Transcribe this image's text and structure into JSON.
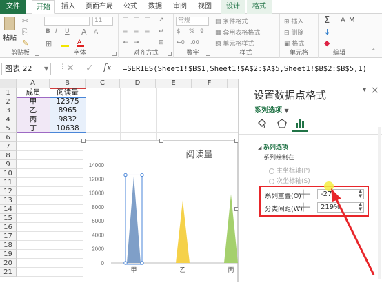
{
  "ribbon": {
    "tabs": [
      "文件",
      "开始",
      "插入",
      "页面布局",
      "公式",
      "数据",
      "审阅",
      "视图",
      "设计",
      "格式"
    ],
    "groups": {
      "clipboard": "剪贴板",
      "font": "字体",
      "alignment": "对齐方式",
      "number": "数字",
      "styles": "样式",
      "cells": "单元格",
      "editing": "编辑"
    },
    "paste_label": "粘贴",
    "font_size": "11",
    "font_bold": "B",
    "font_italic": "I",
    "font_underline": "U",
    "font_grow": "A",
    "font_shrink": "A",
    "number_format": "常规",
    "percent": "%",
    "comma": "9",
    "conditional_format": "条件格式",
    "table_format": "套用表格格式",
    "cell_styles": "单元格样式",
    "insert": "插入",
    "delete": "删除",
    "format": "格式",
    "sum_icon": "Σ",
    "sort_icon": "A",
    "find_icon": "M"
  },
  "formula_bar": {
    "name_box": "图表 22",
    "fx": "fx",
    "formula": "=SERIES(Sheet1!$B$1,Sheet1!$A$2:$A$5,Sheet1!$B$2:$B$5,1)"
  },
  "sheet": {
    "columns": [
      "A",
      "B",
      "C",
      "D",
      "E",
      "F"
    ],
    "rows": [
      "1",
      "2",
      "3",
      "4",
      "5",
      "6",
      "7",
      "8",
      "9",
      "10",
      "11",
      "12",
      "13",
      "14",
      "15",
      "16",
      "17",
      "18",
      "19",
      "20",
      "21"
    ],
    "header": {
      "a": "成员",
      "b": "阅读量"
    },
    "data": [
      {
        "a": "甲",
        "b": "12375"
      },
      {
        "a": "乙",
        "b": "8965"
      },
      {
        "a": "丙",
        "b": "9832"
      },
      {
        "a": "丁",
        "b": "10638"
      }
    ]
  },
  "chart_data": {
    "type": "bar",
    "title": "阅读量",
    "categories": [
      "甲",
      "乙",
      "丙"
    ],
    "series": [
      {
        "values": [
          12375,
          8965,
          9832
        ]
      }
    ],
    "bar_colors": [
      "#7f9fc8",
      "#f5d149",
      "#a5d06d"
    ],
    "yticks": [
      "14000",
      "12000",
      "10000",
      "8000",
      "6000",
      "4000",
      "2000",
      "0"
    ],
    "ylim": [
      0,
      14000
    ],
    "grid": false
  },
  "pane": {
    "title": "设置数据点格式",
    "series_options_dropdown": "系列选项",
    "section_title": "系列选项",
    "plot_on": "系列绘制在",
    "primary_axis": "主坐标轴(P)",
    "secondary_axis": "次坐标轴(S)",
    "overlap_label": "系列重叠(O)",
    "overlap_value": "-27",
    "gap_label": "分类间距(W)",
    "gap_value": "219%",
    "close": "×",
    "pin": "▾"
  },
  "annotation_color": "#e8262a"
}
